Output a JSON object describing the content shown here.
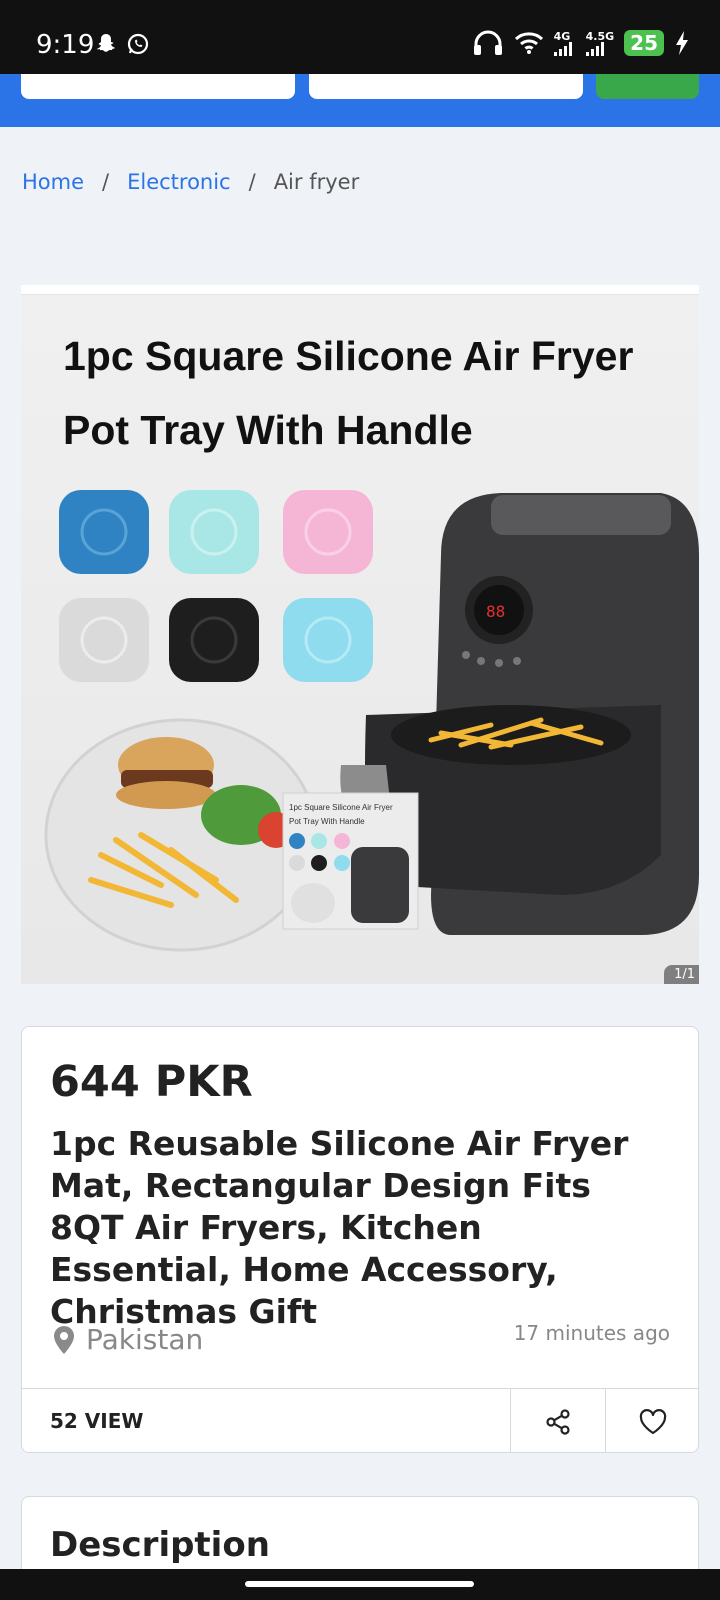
{
  "status_bar": {
    "time": "9:19",
    "network_1": "4G",
    "network_2": "4.5G",
    "battery": "25"
  },
  "breadcrumb": {
    "home": "Home",
    "category": "Electronic",
    "current": "Air fryer",
    "separator": "/"
  },
  "gallery": {
    "image_title_line1": "1pc Square Silicone Air Fryer",
    "image_title_line2": "Pot Tray With Handle",
    "counter": "1/1",
    "thumb_title_line1": "1pc Square Silicone Air Fryer",
    "thumb_title_line2": "Pot Tray With Handle",
    "tray_colors": [
      "#2f83c2",
      "#a9e7e6",
      "#f5b6d6",
      "#dadada",
      "#1e1e1e",
      "#8fdcef"
    ]
  },
  "listing": {
    "price": "644 PKR",
    "title": "1pc Reusable Silicone Air Fryer Mat, Rectangular Design Fits 8QT Air Fryers, Kitchen Essential, Home Accessory, Christmas Gift",
    "location": "Pakistan",
    "posted": "17 minutes ago",
    "views": "52 VIEW"
  },
  "description": {
    "heading": "Description"
  },
  "colors": {
    "header_blue": "#2b74e7",
    "header_green": "#38a84a",
    "link_blue": "#2b74e7"
  }
}
